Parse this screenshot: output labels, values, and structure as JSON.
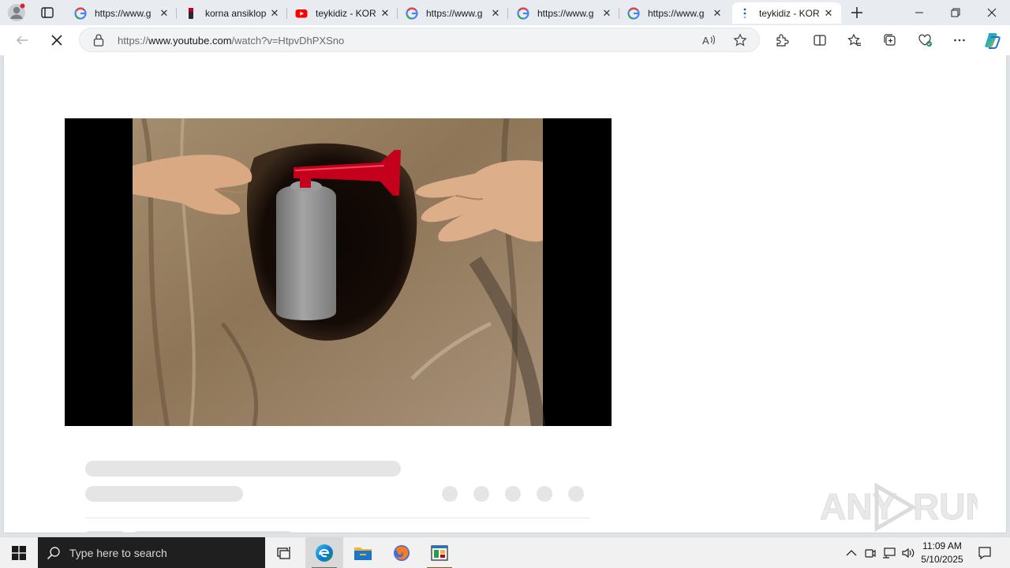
{
  "browser": {
    "tabs": [
      {
        "label": "https://www.g",
        "favicon": "google-favicon",
        "active": false
      },
      {
        "label": "korna ansiklop",
        "favicon": "eksi-favicon",
        "active": false
      },
      {
        "label": "teykidiz - KOR",
        "favicon": "youtube-favicon",
        "active": false
      },
      {
        "label": "https://www.g",
        "favicon": "google-favicon",
        "active": false
      },
      {
        "label": "https://www.g",
        "favicon": "google-favicon",
        "active": false
      },
      {
        "label": "https://www.g",
        "favicon": "google-favicon",
        "active": false
      },
      {
        "label": "teykidiz - KOR",
        "favicon": "loading-icon",
        "active": true
      }
    ],
    "address": {
      "prefix": "https://",
      "domain": "www.youtube.com",
      "path": "/watch?v=HtpvDhPXSno"
    }
  },
  "page": {
    "state": "loading",
    "video_thumbnail": "hands-holding-air-horn-in-tree-hollow",
    "watermark": "ANY RUN"
  },
  "taskbar": {
    "search_placeholder": "Type here to search",
    "time": "11:09 AM",
    "date": "5/10/2025"
  },
  "colors": {
    "accent_red": "#c4001d",
    "youtube_red": "#ff0000",
    "skeleton": "#e5e5e5"
  }
}
